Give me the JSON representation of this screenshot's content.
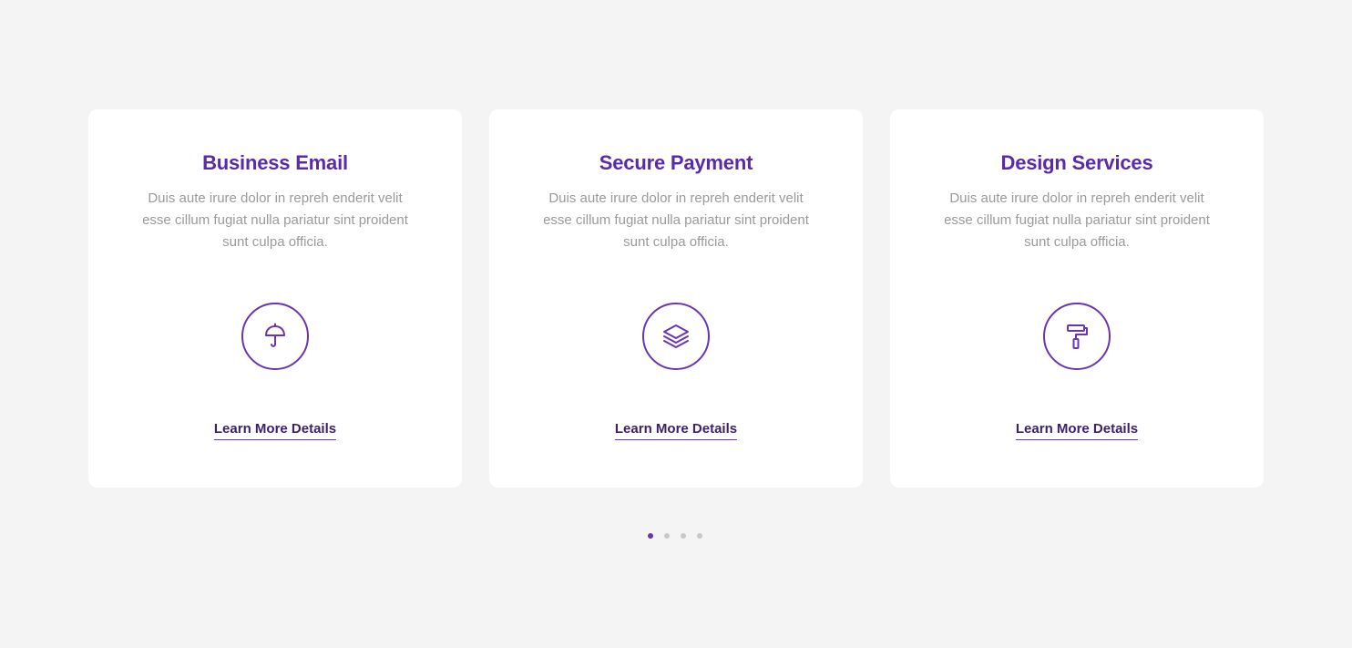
{
  "colors": {
    "background": "#f4f4f4",
    "card": "#ffffff",
    "accent": "#6a35b5",
    "title": "#5b2aa8",
    "link": "#3d1f6e",
    "text_muted": "#9a9a9a",
    "dot_inactive": "#c8c8c8"
  },
  "cards": [
    {
      "title": "Business Email",
      "description": "Duis aute irure dolor in repreh enderit velit esse cillum fugiat nulla pariatur sint proident sunt culpa officia.",
      "icon": "umbrella-icon",
      "link_label": "Learn More Details"
    },
    {
      "title": "Secure Payment",
      "description": "Duis aute irure dolor in repreh enderit velit esse cillum fugiat nulla pariatur sint proident sunt culpa officia.",
      "icon": "layers-icon",
      "link_label": "Learn More Details"
    },
    {
      "title": "Design Services",
      "description": "Duis aute irure dolor in repreh enderit velit esse cillum fugiat nulla pariatur sint proident sunt culpa officia.",
      "icon": "paint-roller-icon",
      "link_label": "Learn More Details"
    }
  ],
  "carousel": {
    "total_pages": 4,
    "active_index": 0
  }
}
